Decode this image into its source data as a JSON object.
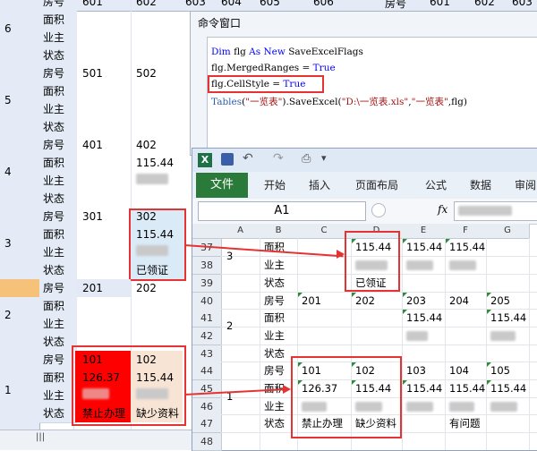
{
  "background_sheet": {
    "header_cols": [
      "房号",
      "601",
      "602",
      "603",
      "604",
      "605",
      "606",
      "房号",
      "601",
      "602",
      "603"
    ],
    "field_labels": [
      "房号",
      "面积",
      "业主",
      "状态"
    ],
    "groups": [
      {
        "num": "6",
        "room_a": "601",
        "room_b": "602",
        "area_b": "",
        "status_b": ""
      },
      {
        "num": "5",
        "room_a": "501",
        "room_b": "502",
        "area_b": "",
        "status_b": ""
      },
      {
        "num": "4",
        "room_a": "401",
        "room_b": "402",
        "area_b": "115.44",
        "status_b": ""
      },
      {
        "num": "3",
        "room_a": "301",
        "room_b": "302",
        "area_b": "115.44",
        "status_b": "已领证"
      },
      {
        "num": "2",
        "room_a": "201",
        "room_b": "202",
        "area_b": "",
        "status_b": ""
      },
      {
        "num": "1",
        "room_a": "101",
        "room_b": "102",
        "area_a": "126.37",
        "area_b": "115.44",
        "status_a": "禁止办理",
        "status_b": "缺少资料"
      }
    ]
  },
  "command_window": {
    "title": "命令窗口",
    "code_lines": [
      {
        "parts": [
          [
            "kw",
            "Dim "
          ],
          [
            "",
            "flg "
          ],
          [
            "kw",
            "As New "
          ],
          [
            "",
            "SaveExcelFlags"
          ]
        ]
      },
      {
        "parts": [
          [
            "",
            "flg.MergedRanges = "
          ],
          [
            "kw",
            "True"
          ]
        ]
      },
      {
        "parts": [
          [
            "",
            "flg.CellStyle = "
          ],
          [
            "kw",
            "True"
          ]
        ]
      },
      {
        "parts": [
          [
            "tab",
            "Tables"
          ],
          [
            "",
            "("
          ],
          [
            "str",
            "\"一览表\""
          ],
          [
            "",
            ").SaveExcel("
          ],
          [
            "str",
            "\"D:\\一览表.xls\""
          ],
          [
            "",
            ","
          ],
          [
            "str",
            "\"一览表\""
          ],
          [
            "",
            ",flg)"
          ]
        ]
      }
    ]
  },
  "excel": {
    "ribbon_tabs": [
      "文件",
      "开始",
      "插入",
      "页面布局",
      "公式",
      "数据",
      "审阅"
    ],
    "name_box": "A1",
    "fx": "fx",
    "columns": [
      "A",
      "B",
      "C",
      "D",
      "E",
      "F",
      "G"
    ],
    "rows": [
      {
        "n": "37",
        "b": "面积",
        "c": "",
        "d": "115.44",
        "e": "115.44",
        "f": "115.44",
        "g": ""
      },
      {
        "n": "38",
        "b": "业主",
        "c": "",
        "d": "",
        "e": "",
        "f": "",
        "g": ""
      },
      {
        "n": "39",
        "b": "状态",
        "c": "",
        "d": "已领证",
        "e": "",
        "f": "",
        "g": ""
      },
      {
        "n": "40",
        "b": "房号",
        "c": "201",
        "d": "202",
        "e": "203",
        "f": "204",
        "g": "205"
      },
      {
        "n": "41",
        "b": "面积",
        "c": "",
        "d": "",
        "e": "115.44",
        "f": "",
        "g": "115.44"
      },
      {
        "n": "42",
        "b": "业主",
        "c": "",
        "d": "",
        "e": "",
        "f": "",
        "g": ""
      },
      {
        "n": "43",
        "b": "状态",
        "c": "",
        "d": "",
        "e": "",
        "f": "",
        "g": ""
      },
      {
        "n": "44",
        "b": "房号",
        "c": "101",
        "d": "102",
        "e": "103",
        "f": "104",
        "g": "105"
      },
      {
        "n": "45",
        "b": "面积",
        "c": "126.37",
        "d": "115.44",
        "e": "115.44",
        "f": "115.44",
        "g": "115.44"
      },
      {
        "n": "46",
        "b": "业主",
        "c": "",
        "d": "",
        "e": "",
        "f": "",
        "g": ""
      },
      {
        "n": "47",
        "b": "状态",
        "c": "禁止办理",
        "d": "缺少资料",
        "e": "",
        "f": "有问题",
        "g": ""
      },
      {
        "n": "48",
        "b": "",
        "c": "",
        "d": "",
        "e": "",
        "f": "",
        "g": ""
      }
    ],
    "group_nums": [
      "3",
      "2",
      "1"
    ]
  },
  "colors": {
    "highlight_red": "#ff0000",
    "light_blue": "#dbeaf7",
    "peach": "#f7e4d5",
    "excel_green": "#2a7a3a",
    "annotation_red": "#e53333"
  }
}
